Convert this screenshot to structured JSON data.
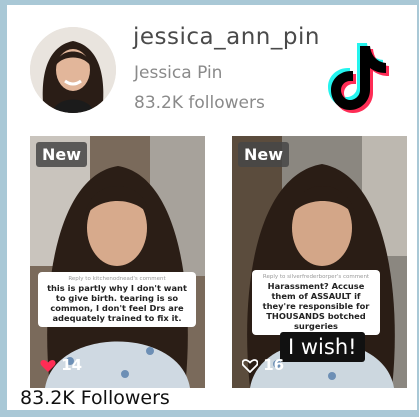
{
  "profile": {
    "username": "jessica_ann_pin",
    "display_name": "Jessica Pin",
    "followers": "83.2K followers"
  },
  "logo": {
    "icon": "tiktok-logo"
  },
  "videos": [
    {
      "badge": "New",
      "reply_meta": "Reply to kitchenodnead's comment",
      "reply_text": "this is partly why I don't want to give birth. tearing is so common, I don't feel Drs are adequately trained to fix it.",
      "likes": "14",
      "like_icon": "heart-filled-icon"
    },
    {
      "badge": "New",
      "reply_meta": "Reply to silverfrederborper's comment",
      "reply_text": "Harassment? Accuse them of ASSAULT if they're responsible for THOUSANDS botched surgeries",
      "likes": "16",
      "like_icon": "heart-outline-icon",
      "overlay_text": "I wish!"
    }
  ],
  "caption": "83.2K Followers",
  "colors": {
    "frame": "#a9c8d6",
    "tiktok_cyan": "#25f4ee",
    "tiktok_red": "#fe2c55",
    "heart": "#ff2d55"
  }
}
